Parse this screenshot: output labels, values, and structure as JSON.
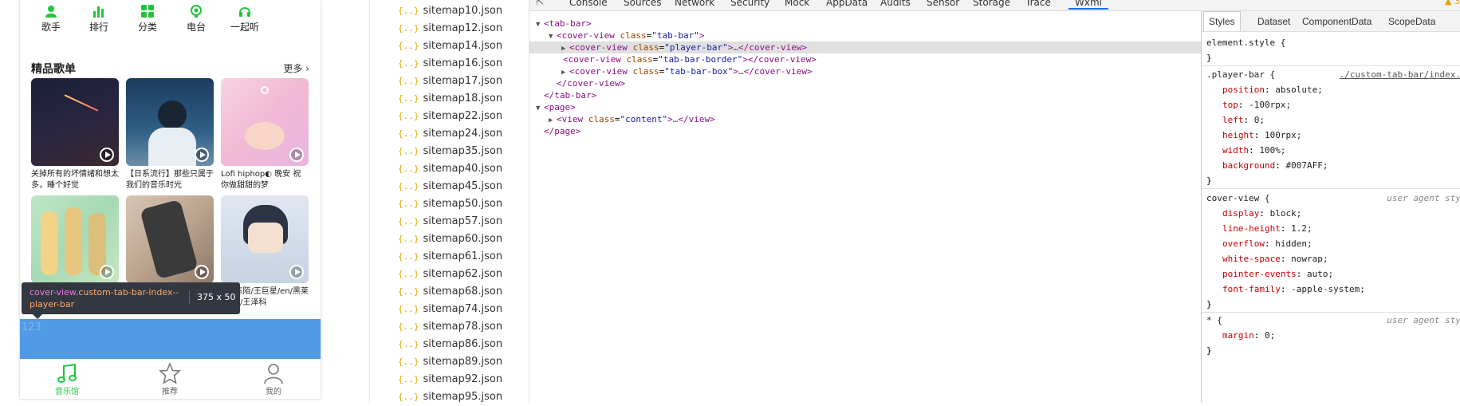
{
  "phone": {
    "categories": [
      {
        "label": "歌手",
        "icon": "singer-icon"
      },
      {
        "label": "排行",
        "icon": "chart-bars-icon"
      },
      {
        "label": "分类",
        "icon": "grid-icon"
      },
      {
        "label": "电台",
        "icon": "radio-icon"
      },
      {
        "label": "一起听",
        "icon": "headphones-icon"
      }
    ],
    "section_title": "精品歌单",
    "section_more": "更多",
    "playlists": [
      {
        "caption": "关掉所有的坏情绪和想太多，睡个好觉"
      },
      {
        "caption": "【日系流行】那些只属于我们的音乐时光"
      },
      {
        "caption": "Lofi hiphop◐ 晚安 祝你做甜甜的梦"
      },
      {
        "caption": ""
      },
      {
        "caption": ""
      },
      {
        "caption": "/陈陌/王巨星/en/黑莱莱/王泽科"
      }
    ],
    "player_bar_text": "123",
    "tooltip": {
      "tag": "cover-view",
      "cls": ".custom-tab-bar-index--player-bar",
      "size": "375 x 50"
    },
    "tabs": [
      {
        "label": "音乐馆",
        "icon": "music-note-icon",
        "color": "#1ec73a"
      },
      {
        "label": "推荐",
        "icon": "star-icon",
        "color": "#666666"
      },
      {
        "label": "我的",
        "icon": "user-icon",
        "color": "#666666"
      }
    ],
    "colors": {
      "accent": "#1ec73a",
      "player_bar": "#4a98e8"
    }
  },
  "files": [
    "sitemap10.json",
    "sitemap12.json",
    "sitemap14.json",
    "sitemap16.json",
    "sitemap17.json",
    "sitemap18.json",
    "sitemap22.json",
    "sitemap24.json",
    "sitemap35.json",
    "sitemap40.json",
    "sitemap45.json",
    "sitemap50.json",
    "sitemap57.json",
    "sitemap60.json",
    "sitemap61.json",
    "sitemap62.json",
    "sitemap68.json",
    "sitemap74.json",
    "sitemap78.json",
    "sitemap86.json",
    "sitemap89.json",
    "sitemap92.json",
    "sitemap95.json"
  ],
  "devtools": {
    "tabs": [
      "Console",
      "Sources",
      "Network",
      "Security",
      "Mock",
      "AppData",
      "Audits",
      "Sensor",
      "Storage",
      "Trace",
      "Wxml"
    ],
    "active_tab": "Wxml",
    "warning_count": "3",
    "tree": {
      "tab_bar_open": "<tab-bar>",
      "cover_view_tag": "<cover-view",
      "class_attr": "class",
      "tab_bar_val": "\"tab-bar\"",
      "player_bar_val": "\"player-bar\"",
      "border_val": "\"tab-bar-border\"",
      "box_val": "\"tab-bar-box\"",
      "ellipsis": "…",
      "cover_view_close": "</cover-view>",
      "tab_bar_close": "</tab-bar>",
      "page_open": "<page>",
      "view_tag": "<view",
      "content_val": "\"content\"",
      "view_close": "</view>",
      "page_close": "</page>"
    },
    "styles_tabs": [
      "Styles",
      "Dataset",
      "ComponentData",
      "ScopeData"
    ],
    "rules": {
      "element_style": "element.style {",
      "player_bar_selector": ".player-bar {",
      "player_bar_source": "./custom-tab-bar/index.",
      "player_bar_props": [
        {
          "name": "position",
          "value": "absolute;"
        },
        {
          "name": "top",
          "value": "-100rpx;"
        },
        {
          "name": "left",
          "value": "0;"
        },
        {
          "name": "height",
          "value": "100rpx;"
        },
        {
          "name": "width",
          "value": "100%;"
        },
        {
          "name": "background",
          "value": "#007AFF;"
        }
      ],
      "cover_view_selector": "cover-view {",
      "ua_label": "user agent sty",
      "cover_view_props": [
        {
          "name": "display",
          "value": "block;"
        },
        {
          "name": "line-height",
          "value": "1.2;"
        },
        {
          "name": "overflow",
          "value": "hidden;"
        },
        {
          "name": "white-space",
          "value": "nowrap;"
        },
        {
          "name": "pointer-events",
          "value": "auto;"
        },
        {
          "name": "font-family",
          "value": "-apple-system;"
        }
      ],
      "star_selector": "* {",
      "star_props": [
        {
          "name": "margin",
          "value": "0;"
        }
      ],
      "close_brace": "}"
    }
  }
}
